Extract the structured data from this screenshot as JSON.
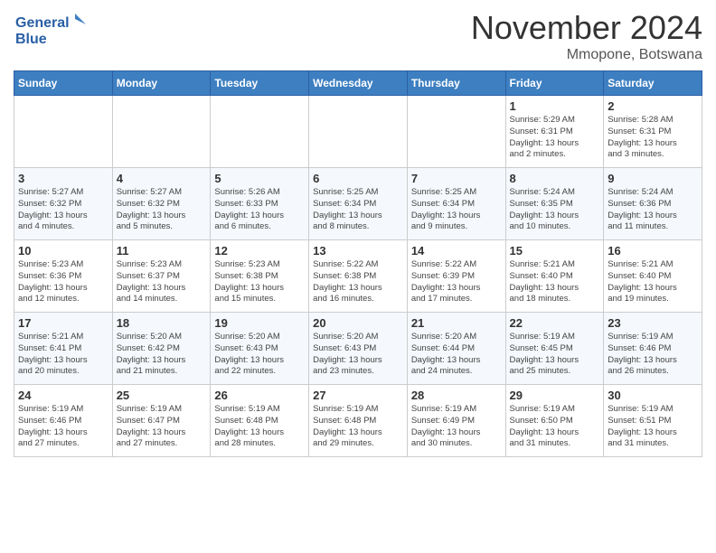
{
  "logo": {
    "line1": "General",
    "line2": "Blue"
  },
  "title": "November 2024",
  "location": "Mmopone, Botswana",
  "days_of_week": [
    "Sunday",
    "Monday",
    "Tuesday",
    "Wednesday",
    "Thursday",
    "Friday",
    "Saturday"
  ],
  "weeks": [
    [
      {
        "day": "",
        "info": ""
      },
      {
        "day": "",
        "info": ""
      },
      {
        "day": "",
        "info": ""
      },
      {
        "day": "",
        "info": ""
      },
      {
        "day": "",
        "info": ""
      },
      {
        "day": "1",
        "info": "Sunrise: 5:29 AM\nSunset: 6:31 PM\nDaylight: 13 hours\nand 2 minutes."
      },
      {
        "day": "2",
        "info": "Sunrise: 5:28 AM\nSunset: 6:31 PM\nDaylight: 13 hours\nand 3 minutes."
      }
    ],
    [
      {
        "day": "3",
        "info": "Sunrise: 5:27 AM\nSunset: 6:32 PM\nDaylight: 13 hours\nand 4 minutes."
      },
      {
        "day": "4",
        "info": "Sunrise: 5:27 AM\nSunset: 6:32 PM\nDaylight: 13 hours\nand 5 minutes."
      },
      {
        "day": "5",
        "info": "Sunrise: 5:26 AM\nSunset: 6:33 PM\nDaylight: 13 hours\nand 6 minutes."
      },
      {
        "day": "6",
        "info": "Sunrise: 5:25 AM\nSunset: 6:34 PM\nDaylight: 13 hours\nand 8 minutes."
      },
      {
        "day": "7",
        "info": "Sunrise: 5:25 AM\nSunset: 6:34 PM\nDaylight: 13 hours\nand 9 minutes."
      },
      {
        "day": "8",
        "info": "Sunrise: 5:24 AM\nSunset: 6:35 PM\nDaylight: 13 hours\nand 10 minutes."
      },
      {
        "day": "9",
        "info": "Sunrise: 5:24 AM\nSunset: 6:36 PM\nDaylight: 13 hours\nand 11 minutes."
      }
    ],
    [
      {
        "day": "10",
        "info": "Sunrise: 5:23 AM\nSunset: 6:36 PM\nDaylight: 13 hours\nand 12 minutes."
      },
      {
        "day": "11",
        "info": "Sunrise: 5:23 AM\nSunset: 6:37 PM\nDaylight: 13 hours\nand 14 minutes."
      },
      {
        "day": "12",
        "info": "Sunrise: 5:23 AM\nSunset: 6:38 PM\nDaylight: 13 hours\nand 15 minutes."
      },
      {
        "day": "13",
        "info": "Sunrise: 5:22 AM\nSunset: 6:38 PM\nDaylight: 13 hours\nand 16 minutes."
      },
      {
        "day": "14",
        "info": "Sunrise: 5:22 AM\nSunset: 6:39 PM\nDaylight: 13 hours\nand 17 minutes."
      },
      {
        "day": "15",
        "info": "Sunrise: 5:21 AM\nSunset: 6:40 PM\nDaylight: 13 hours\nand 18 minutes."
      },
      {
        "day": "16",
        "info": "Sunrise: 5:21 AM\nSunset: 6:40 PM\nDaylight: 13 hours\nand 19 minutes."
      }
    ],
    [
      {
        "day": "17",
        "info": "Sunrise: 5:21 AM\nSunset: 6:41 PM\nDaylight: 13 hours\nand 20 minutes."
      },
      {
        "day": "18",
        "info": "Sunrise: 5:20 AM\nSunset: 6:42 PM\nDaylight: 13 hours\nand 21 minutes."
      },
      {
        "day": "19",
        "info": "Sunrise: 5:20 AM\nSunset: 6:43 PM\nDaylight: 13 hours\nand 22 minutes."
      },
      {
        "day": "20",
        "info": "Sunrise: 5:20 AM\nSunset: 6:43 PM\nDaylight: 13 hours\nand 23 minutes."
      },
      {
        "day": "21",
        "info": "Sunrise: 5:20 AM\nSunset: 6:44 PM\nDaylight: 13 hours\nand 24 minutes."
      },
      {
        "day": "22",
        "info": "Sunrise: 5:19 AM\nSunset: 6:45 PM\nDaylight: 13 hours\nand 25 minutes."
      },
      {
        "day": "23",
        "info": "Sunrise: 5:19 AM\nSunset: 6:46 PM\nDaylight: 13 hours\nand 26 minutes."
      }
    ],
    [
      {
        "day": "24",
        "info": "Sunrise: 5:19 AM\nSunset: 6:46 PM\nDaylight: 13 hours\nand 27 minutes."
      },
      {
        "day": "25",
        "info": "Sunrise: 5:19 AM\nSunset: 6:47 PM\nDaylight: 13 hours\nand 27 minutes."
      },
      {
        "day": "26",
        "info": "Sunrise: 5:19 AM\nSunset: 6:48 PM\nDaylight: 13 hours\nand 28 minutes."
      },
      {
        "day": "27",
        "info": "Sunrise: 5:19 AM\nSunset: 6:48 PM\nDaylight: 13 hours\nand 29 minutes."
      },
      {
        "day": "28",
        "info": "Sunrise: 5:19 AM\nSunset: 6:49 PM\nDaylight: 13 hours\nand 30 minutes."
      },
      {
        "day": "29",
        "info": "Sunrise: 5:19 AM\nSunset: 6:50 PM\nDaylight: 13 hours\nand 31 minutes."
      },
      {
        "day": "30",
        "info": "Sunrise: 5:19 AM\nSunset: 6:51 PM\nDaylight: 13 hours\nand 31 minutes."
      }
    ]
  ]
}
